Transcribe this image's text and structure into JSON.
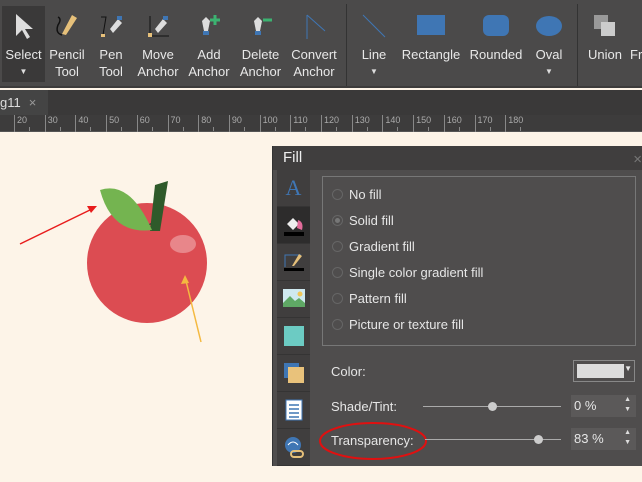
{
  "toolbar": {
    "tools": [
      {
        "label1": "Select",
        "label2": ""
      },
      {
        "label1": "Pencil",
        "label2": "Tool"
      },
      {
        "label1": "Pen",
        "label2": "Tool"
      },
      {
        "label1": "Move",
        "label2": "Anchor"
      },
      {
        "label1": "Add",
        "label2": "Anchor"
      },
      {
        "label1": "Delete",
        "label2": "Anchor"
      },
      {
        "label1": "Convert",
        "label2": "Anchor"
      },
      {
        "label1": "Line",
        "label2": ""
      },
      {
        "label1": "Rectangle",
        "label2": ""
      },
      {
        "label1": "Rounded",
        "label2": ""
      },
      {
        "label1": "Oval",
        "label2": ""
      },
      {
        "label1": "Union",
        "label2": ""
      },
      {
        "label1": "Fr",
        "label2": ""
      }
    ]
  },
  "tab": {
    "label": "g11",
    "close": "×"
  },
  "ruler": {
    "labels": [
      "20",
      "30",
      "40",
      "50",
      "60",
      "70",
      "80",
      "90",
      "100",
      "110",
      "120",
      "130",
      "140",
      "150",
      "160",
      "170",
      "180"
    ]
  },
  "panel": {
    "title": "Fill",
    "close": "×",
    "options": [
      "No fill",
      "Solid fill",
      "Gradient fill",
      "Single color gradient fill",
      "Pattern fill",
      "Picture or texture fill"
    ],
    "selected": 1,
    "color_label": "Color:",
    "color_value": "#dcdcdc",
    "shade_label": "Shade/Tint:",
    "shade_value": "0 %",
    "shade_fraction": 0.5,
    "transparency_label": "Transparency:",
    "transparency_value": "83 %",
    "transparency_fraction": 0.83
  },
  "colors": {
    "apple": "#dc4c52",
    "accent_blue": "#3f76b4",
    "highlight_ellipse": "#e01010"
  }
}
